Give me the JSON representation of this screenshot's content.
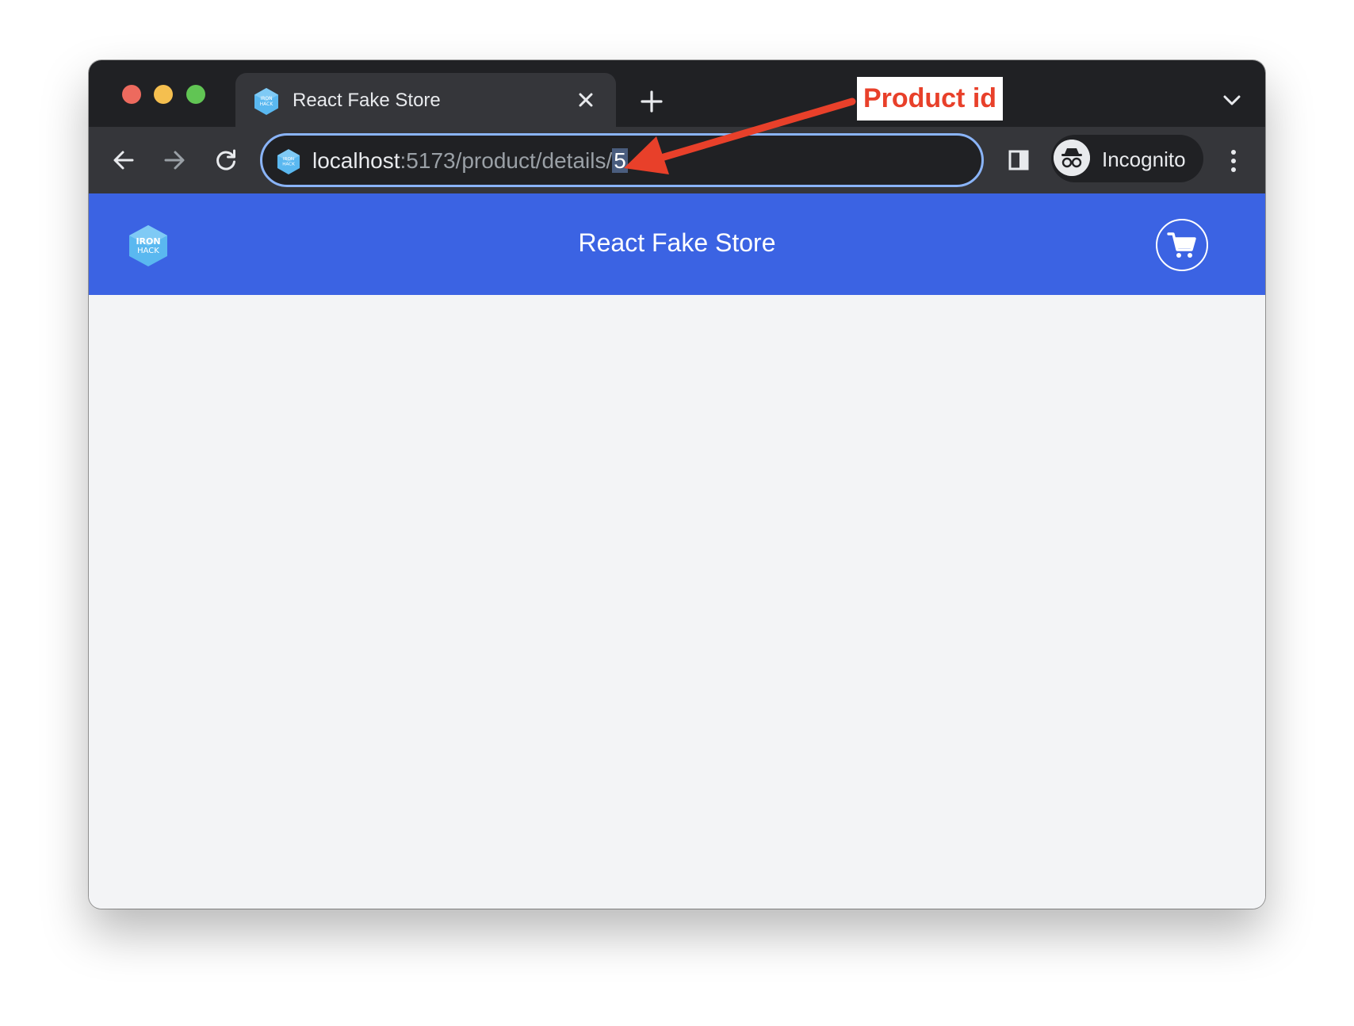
{
  "browser": {
    "tab": {
      "title": "React Fake Store"
    },
    "address_bar": {
      "host": "localhost",
      "path": ":5173/product/details/",
      "selected": "5"
    },
    "profile": {
      "label": "Incognito"
    }
  },
  "annotation": {
    "label": "Product id",
    "color": "#e8402a"
  },
  "app": {
    "header": {
      "title": "React Fake Store",
      "background": "#3b63e3"
    },
    "logo": {
      "line1": "IRON",
      "line2": "HACK"
    }
  },
  "icons": {
    "tab_favicon": "ironhack-hexagon-icon",
    "close": "close-icon",
    "new_tab": "plus-icon",
    "tab_search": "chevron-down-icon",
    "back": "arrow-left-icon",
    "forward": "arrow-right-icon",
    "reload": "reload-icon",
    "side_panel": "side-panel-icon",
    "incognito": "incognito-icon",
    "menu": "vertical-dots-icon",
    "cart": "shopping-cart-icon"
  }
}
